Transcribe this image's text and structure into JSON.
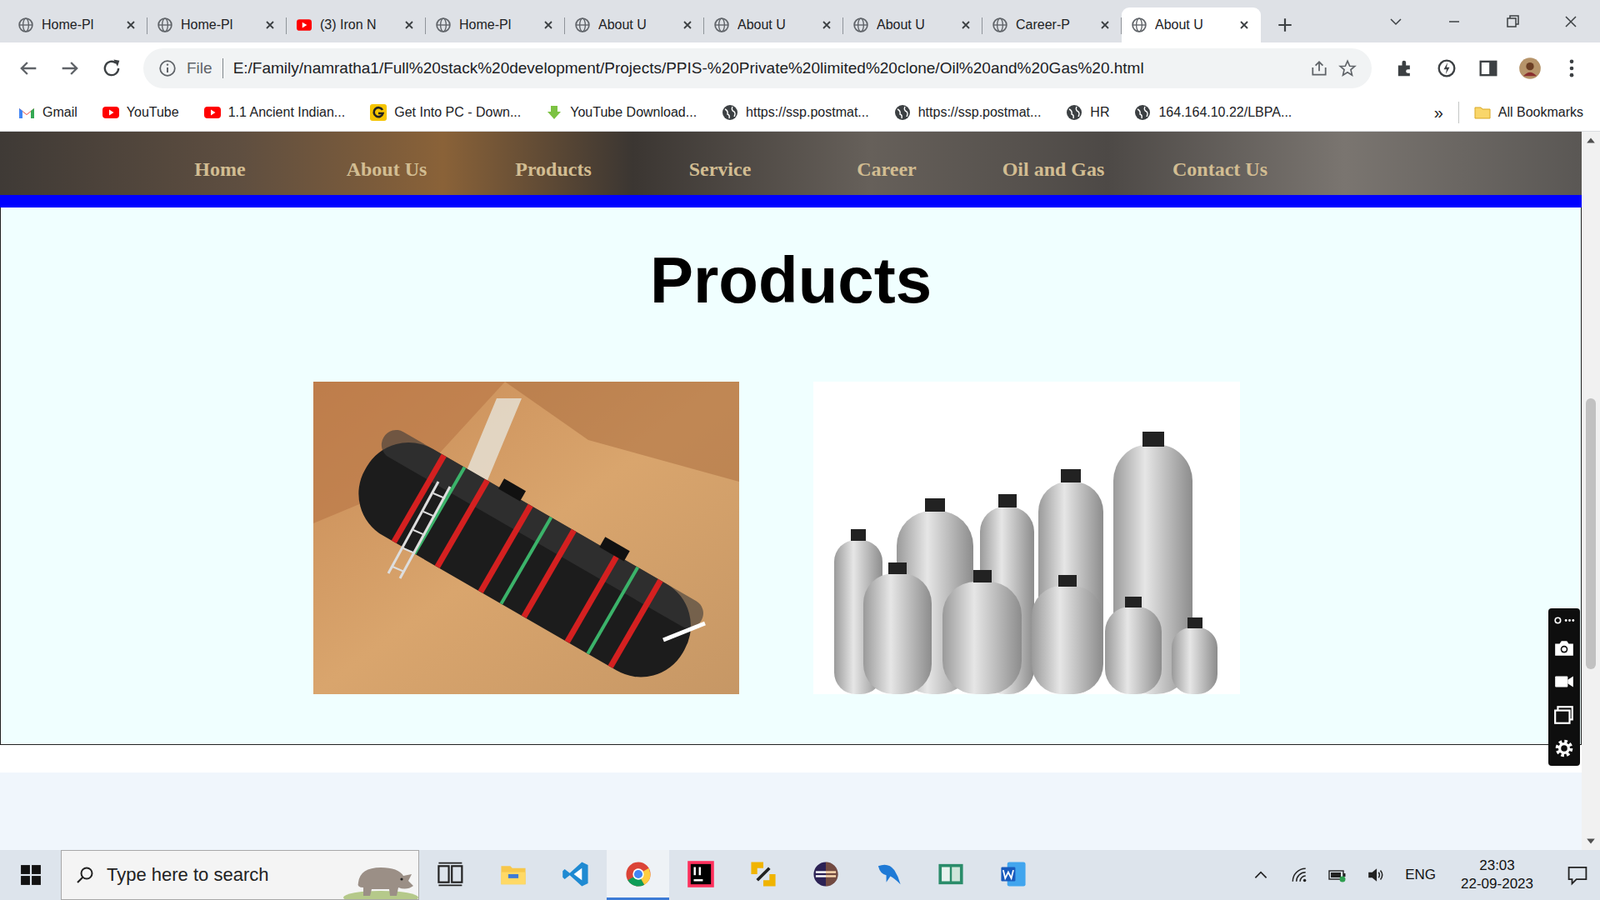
{
  "browser": {
    "tabs": [
      {
        "label": "Home-Pl",
        "kind": "page",
        "selected": false
      },
      {
        "label": "Home-Pl",
        "kind": "page",
        "selected": false
      },
      {
        "label": "(3) Iron N",
        "kind": "youtube",
        "selected": false
      },
      {
        "label": "Home-Pl",
        "kind": "page",
        "selected": false
      },
      {
        "label": "About U",
        "kind": "page",
        "selected": false
      },
      {
        "label": "About U",
        "kind": "page",
        "selected": false
      },
      {
        "label": "About U",
        "kind": "page",
        "selected": false
      },
      {
        "label": "Career-P",
        "kind": "page",
        "selected": false
      },
      {
        "label": "About U",
        "kind": "page",
        "selected": true
      }
    ],
    "address": {
      "scheme": "File",
      "url": "E:/Family/namratha1/Full%20stack%20development/Projects/PPIS-%20Private%20limited%20clone/Oil%20and%20Gas%20.html"
    },
    "bookmarks": [
      {
        "label": "Gmail",
        "kind": "gmail"
      },
      {
        "label": "YouTube",
        "kind": "youtube"
      },
      {
        "label": "1.1 Ancient Indian...",
        "kind": "youtube"
      },
      {
        "label": "Get Into PC - Down...",
        "kind": "getinto"
      },
      {
        "label": "YouTube Download...",
        "kind": "download"
      },
      {
        "label": "https://ssp.postmat...",
        "kind": "globe"
      },
      {
        "label": "https://ssp.postmat...",
        "kind": "globe"
      },
      {
        "label": "HR",
        "kind": "globe"
      },
      {
        "label": "164.164.10.22/LBPA...",
        "kind": "globe"
      }
    ],
    "bookmarks_more": "»",
    "all_bookmarks": "All Bookmarks"
  },
  "page": {
    "nav": [
      "Home",
      "About Us",
      "Products",
      "Service",
      "Career",
      "Oil and Gas",
      "Contact Us"
    ],
    "heading": "Products",
    "products": [
      {
        "kind": "tank"
      },
      {
        "kind": "vessels"
      }
    ]
  },
  "taskbar": {
    "search_placeholder": "Type here to search",
    "apps": [
      {
        "kind": "task-view",
        "selected": false
      },
      {
        "kind": "explorer",
        "selected": false
      },
      {
        "kind": "vscode",
        "selected": false
      },
      {
        "kind": "chrome",
        "selected": true
      },
      {
        "kind": "intellij",
        "selected": false
      },
      {
        "kind": "tool",
        "selected": false
      },
      {
        "kind": "eclipse",
        "selected": false
      },
      {
        "kind": "mysql",
        "selected": false
      },
      {
        "kind": "app",
        "selected": false
      },
      {
        "kind": "word",
        "selected": false
      }
    ],
    "language": "ENG",
    "time": "23:03",
    "date": "22-09-2023"
  }
}
